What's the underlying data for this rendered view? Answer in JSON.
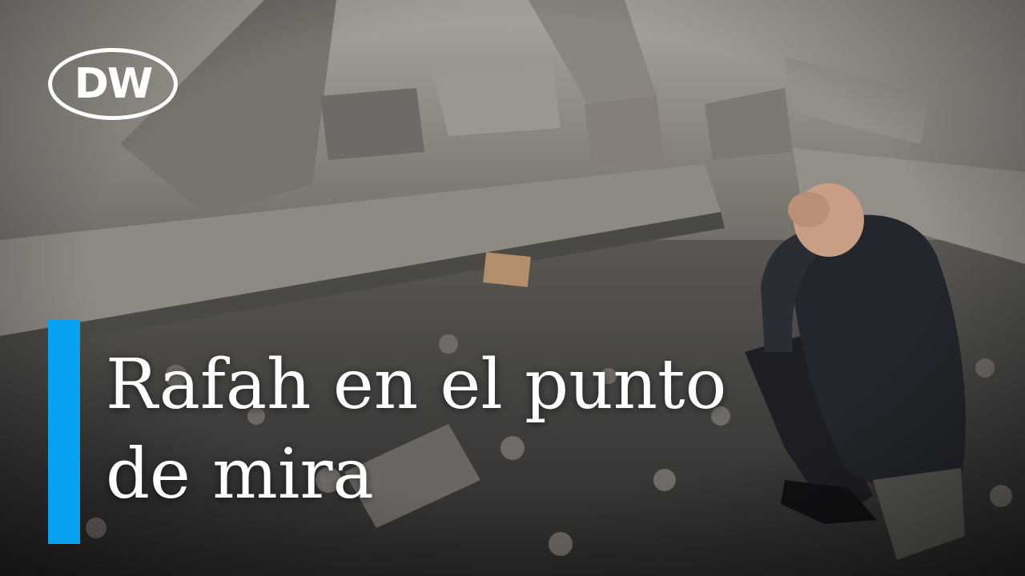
{
  "logo": {
    "text": "DW",
    "colors": {
      "logo": "#ffffff"
    }
  },
  "headline": {
    "lines": [
      "Rafah en el punto",
      "de mira"
    ]
  },
  "colors": {
    "accent_bar": "#0aa2f0",
    "headline_text": "#ffffff"
  },
  "scene": {
    "description_icon": "rubble-photo"
  }
}
